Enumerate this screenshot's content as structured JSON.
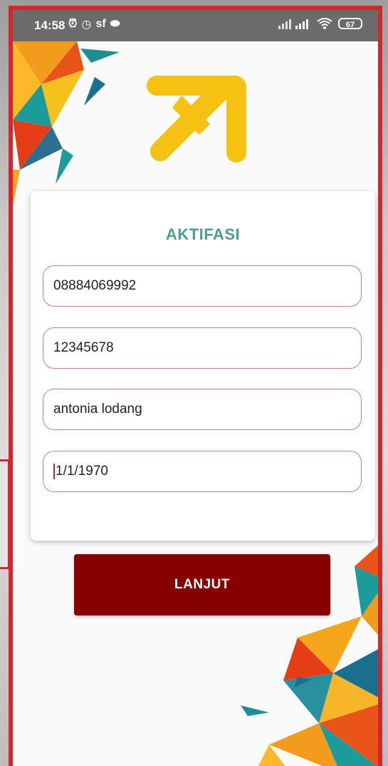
{
  "status_bar": {
    "time": "14:58",
    "carrier_icon_text": "sf",
    "battery": "67"
  },
  "colors": {
    "frame_red": "#d5262e",
    "title_teal": "#4f9e8c",
    "button_maroon": "#870000",
    "logo_yellow": "#f5c211",
    "field_border": "#c88088"
  },
  "icons": [
    "alarm-off-icon",
    "alarm-clock-icon",
    "circle-icon",
    "signal-icon",
    "wifi-icon",
    "battery-icon"
  ],
  "form": {
    "title": "AKTIFASI",
    "phone_value": "08884069992",
    "code_value": "12345678",
    "name_value": "antonia lodang",
    "date_value": "1/1/1970"
  },
  "actions": {
    "next_label": "LANJUT"
  }
}
